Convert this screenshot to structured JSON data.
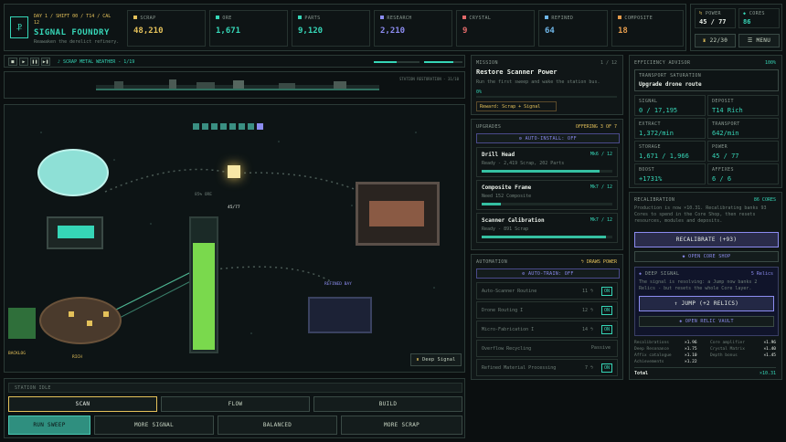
{
  "header": {
    "day_line": "DAY 1 / SHIFT 00 / T14 / CAL",
    "day_line2": "12",
    "title": "SIGNAL FOUNDRY",
    "subtitle": "Reawaken the derelict refinery."
  },
  "resources": [
    {
      "label": "SCRAP",
      "value": "48,210",
      "color": "#e4c15a"
    },
    {
      "label": "ORE",
      "value": "1,671",
      "color": "#36d6b7"
    },
    {
      "label": "PARTS",
      "value": "9,120",
      "color": "#36d6b7"
    },
    {
      "label": "RESEARCH",
      "value": "2,210",
      "color": "#8c8cf0"
    },
    {
      "label": "CRYSTAL",
      "value": "9",
      "color": "#e36a6a"
    },
    {
      "label": "REFINED",
      "value": "64",
      "color": "#6fb6e8"
    },
    {
      "label": "COMPOSITE",
      "value": "18",
      "color": "#e39b4c"
    }
  ],
  "top_right": {
    "power_label": "POWER",
    "power_value": "45 / 77",
    "cores_label": "CORES",
    "cores_value": "86",
    "counter": "22/30",
    "menu": "MENU"
  },
  "transport": {
    "track": "SCRAP METAL WEATHER - 1/19",
    "vol1": 0.5,
    "vol2": 0.75,
    "station_text": "STATION RESTORATION - 31/10"
  },
  "map": {
    "ore_pct": "85% ORE",
    "power_fill": "45/77",
    "ore_fill": 0.8,
    "refined_bay": "REFINED BAY",
    "backlog": "BACKLOG",
    "rich": "RICH",
    "deep_signal": "Deep Signal"
  },
  "bottom": {
    "station_idle": "STATION IDLE",
    "tabs": [
      "SCAN",
      "FLOW",
      "BUILD"
    ],
    "actions": [
      "RUN SWEEP",
      "MORE SIGNAL",
      "BALANCED",
      "MORE SCRAP"
    ]
  },
  "mission": {
    "label": "MISSION",
    "count": "1 / 12",
    "title": "Restore Scanner Power",
    "desc": "Run the first sweep and wake the station bus.",
    "progress": "0%",
    "reward": "Reward: Scrap + Signal"
  },
  "upgrades": {
    "label": "UPGRADES",
    "offering": "OFFERING 3 OF 7",
    "auto": "AUTO-INSTALL: OFF",
    "items": [
      {
        "name": "Drill Head",
        "level": "Mk6 / 12",
        "desc": "Ready - 2,419 Scrap, 202 Parts",
        "fill": 0.9
      },
      {
        "name": "Composite Frame",
        "level": "Mk7 / 12",
        "desc": "Need 152 Composite",
        "fill": 0.15
      },
      {
        "name": "Scanner Calibration",
        "level": "Mk7 / 12",
        "desc": "Ready - 891 Scrap",
        "fill": 0.95
      }
    ]
  },
  "automation": {
    "label": "AUTOMATION",
    "draws": "DRAWS POWER",
    "auto": "AUTO-TRAIN: OFF",
    "items": [
      {
        "name": "Auto-Scanner Routine",
        "cost": "11 ϟ",
        "state": "ON"
      },
      {
        "name": "Drone Routing I",
        "cost": "12 ϟ",
        "state": "ON"
      },
      {
        "name": "Micro-Fabrication I",
        "cost": "14 ϟ",
        "state": "ON"
      },
      {
        "name": "Overflow Recycling",
        "cost": "",
        "state": "Passive"
      },
      {
        "name": "Refined Material Processing",
        "cost": "7 ϟ",
        "state": "ON"
      }
    ]
  },
  "advisor": {
    "label": "EFFICIENCY ADVISOR",
    "pct": "100%",
    "box_label": "TRANSPORT SATURATION",
    "box_title": "Upgrade drone route",
    "cells": [
      {
        "label": "SIGNAL",
        "value": "0 / 17,195"
      },
      {
        "label": "DEPOSIT",
        "value": "T14 Rich"
      },
      {
        "label": "EXTRACT",
        "value": "1,372/min"
      },
      {
        "label": "TRANSPORT",
        "value": "642/min"
      },
      {
        "label": "STORAGE",
        "value": "1,671 / 1,966"
      },
      {
        "label": "POWER",
        "value": "45 / 77"
      },
      {
        "label": "BOOST",
        "value": "+1731%"
      },
      {
        "label": "AFFIXES",
        "value": "6 / 6"
      }
    ]
  },
  "recal": {
    "label": "RECALIBRATION",
    "cores": "86 CORES",
    "text": "Production is now ×10.31. Recalibrating banks 93 Cores to spend in the Core Shop, then resets resources, modules and deposits.",
    "button": "RECALIBRATE (+93)",
    "shop": "OPEN CORE SHOP",
    "deep_label": "DEEP SIGNAL",
    "relics": "5 Relics",
    "deep_text": "The signal is resolving: a Jump now banks 2 Relics - but resets the whole Core layer.",
    "jump": "JUMP (+2 RELICS)",
    "vault": "OPEN RELIC VAULT",
    "mods_left": [
      {
        "k": "Recalibrations",
        "v": "×1.96"
      },
      {
        "k": "Deep Resonance",
        "v": "×1.75"
      },
      {
        "k": "Affix catalogue",
        "v": "×1.10"
      },
      {
        "k": "Achievements",
        "v": "×1.22"
      }
    ],
    "mods_right": [
      {
        "k": "Core amplifier",
        "v": "×1.96"
      },
      {
        "k": "Crystal Matrix",
        "v": "×1.40"
      },
      {
        "k": "Depth bonus",
        "v": "×1.45"
      }
    ],
    "total_k": "Total",
    "total_v": "×10.31"
  }
}
